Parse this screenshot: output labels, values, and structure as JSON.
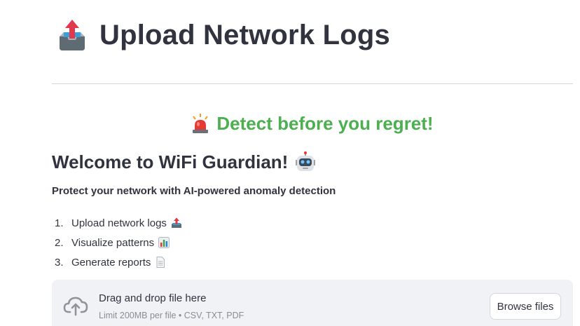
{
  "header": {
    "title": "Upload Network Logs",
    "title_icon": "outbox-tray-icon"
  },
  "banner": {
    "slogan": "Detect before you regret!",
    "slogan_color": "#4caf50",
    "icon": "siren-icon"
  },
  "welcome": {
    "heading": "Welcome to WiFi Guardian!",
    "icon": "robot-icon",
    "tagline": "Protect your network with AI-powered anomaly detection"
  },
  "steps": [
    {
      "number": "1.",
      "label": "Upload network logs",
      "icon": "outbox-tray-icon"
    },
    {
      "number": "2.",
      "label": "Visualize patterns",
      "icon": "bar-chart-icon"
    },
    {
      "number": "3.",
      "label": "Generate reports",
      "icon": "page-icon"
    }
  ],
  "uploader": {
    "drop_text": "Drag and drop file here",
    "limit_text": "Limit 200MB per file • CSV, TXT, PDF",
    "browse_label": "Browse files",
    "icon": "cloud-upload-icon",
    "background": "#f0f2f6"
  }
}
